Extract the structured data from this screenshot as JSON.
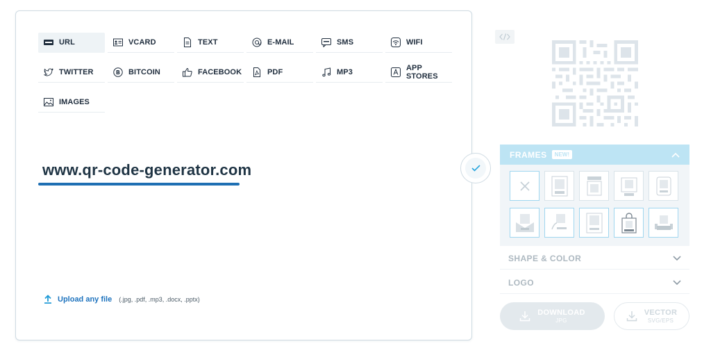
{
  "qr_types": [
    {
      "label": "URL",
      "icon": "url-icon",
      "active": true
    },
    {
      "label": "VCARD",
      "icon": "vcard-icon"
    },
    {
      "label": "TEXT",
      "icon": "text-doc-icon"
    },
    {
      "label": "E-MAIL",
      "icon": "at-icon"
    },
    {
      "label": "SMS",
      "icon": "sms-icon"
    },
    {
      "label": "WIFI",
      "icon": "wifi-icon"
    },
    {
      "label": "TWITTER",
      "icon": "twitter-icon"
    },
    {
      "label": "BITCOIN",
      "icon": "bitcoin-icon"
    },
    {
      "label": "FACEBOOK",
      "icon": "thumbs-up-icon"
    },
    {
      "label": "PDF",
      "icon": "pdf-icon"
    },
    {
      "label": "MP3",
      "icon": "music-note-icon"
    },
    {
      "label": "APP STORES",
      "icon": "app-store-icon"
    },
    {
      "label": "IMAGES",
      "icon": "image-icon"
    }
  ],
  "url_input": {
    "value": "www.qr-code-generator.com"
  },
  "upload": {
    "label": "Upload any file",
    "extensions": "(.jpg, .pdf, .mp3, .docx, .pptx)"
  },
  "frames": {
    "title": "FRAMES",
    "badge": "NEW!"
  },
  "shape_color": {
    "title": "SHAPE & COLOR"
  },
  "logo": {
    "title": "LOGO"
  },
  "download": {
    "label": "DOWNLOAD",
    "sub": "JPG"
  },
  "vector": {
    "label": "VECTOR",
    "sub": "SVG/EPS"
  },
  "colors": {
    "accent": "#1e6fb3",
    "frames_header": "#bde4f4",
    "muted": "#aeb9c1"
  }
}
